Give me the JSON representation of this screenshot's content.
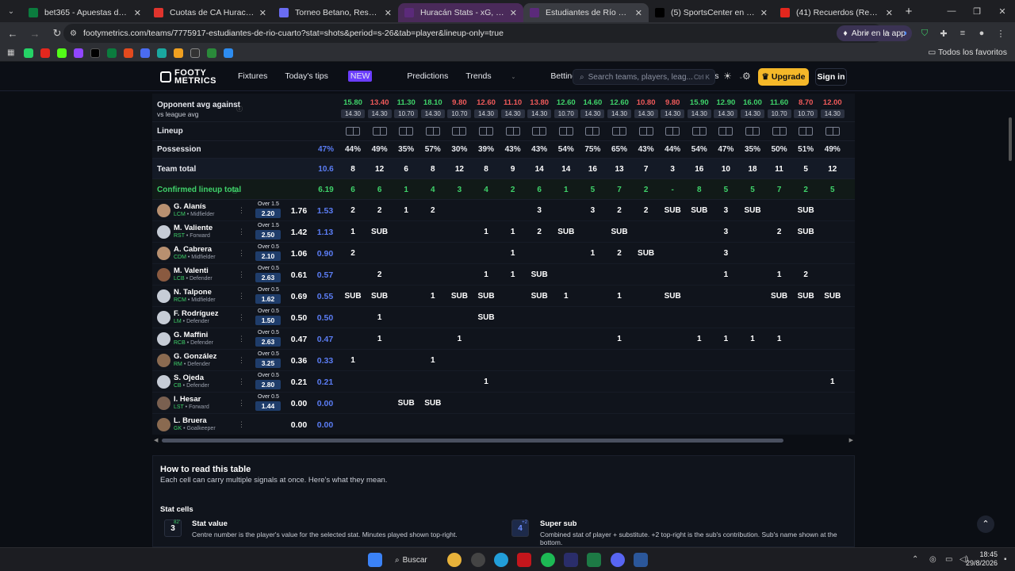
{
  "browser": {
    "tabs": [
      {
        "title": "bet365 - Apuestas deportivas e",
        "color": "#0b7c3e"
      },
      {
        "title": "Cuotas de CA Huracan - Estudi",
        "color": "#e0342d"
      },
      {
        "title": "Torneo Betano, Resultados",
        "color": "#6a6cf2"
      },
      {
        "title": "Huracán Stats - xG, Shots & Mi",
        "color": "#5b2a7a"
      },
      {
        "title": "Estudiantes de Río Cuarto Stats",
        "color": "#5b2a7a"
      },
      {
        "title": "(5) SportsCenter en X: \"¡EL SÁB",
        "color": "#000000"
      },
      {
        "title": "(41) Recuerdos (Remix) (fe",
        "color": "#e3271e"
      }
    ],
    "url": "footymetrics.com/teams/7775917-estudiantes-de-rio-cuarto?stat=shots&period=s-26&tab=player&lineup-only=true",
    "open_in_app": "Abrir en la app",
    "all_bookmarks": "Todos los favoritos"
  },
  "site": {
    "logo_line1": "FOOTY",
    "logo_line2": "METRICS",
    "nav": {
      "fixtures": "Fixtures",
      "tips": "Today's tips",
      "new": "NEW",
      "predictions": "Predictions",
      "trends": "Trends",
      "betting": "Betting tools",
      "stats": "Stats"
    },
    "search_placeholder": "Search teams, players, leag...",
    "search_kbd": "Ctrl K",
    "upgrade": "Upgrade",
    "signin": "Sign in"
  },
  "table": {
    "opp_label": "Opponent avg against",
    "opp_sub": "vs league avg",
    "lineup_label": "Lineup",
    "possession_label": "Possession",
    "possession_avg": "47%",
    "team_total_label": "Team total",
    "team_total_avg": "10.6",
    "confirmed_label": "Confirmed lineup total",
    "confirmed_avg": "6.19",
    "opp_top": [
      "15.80",
      "13.40",
      "11.30",
      "18.10",
      "9.80",
      "12.60",
      "11.10",
      "13.80",
      "12.60",
      "14.60",
      "12.60",
      "10.80",
      "9.80",
      "15.90",
      "12.90",
      "16.00",
      "11.60",
      "8.70",
      "12.00"
    ],
    "opp_top_colors": [
      "#3fd36a",
      "#f05a5a",
      "#3fd36a",
      "#3fd36a",
      "#f05a5a",
      "#f05a5a",
      "#f05a5a",
      "#f05a5a",
      "#3fd36a",
      "#3fd36a",
      "#3fd36a",
      "#f05a5a",
      "#f05a5a",
      "#3fd36a",
      "#3fd36a",
      "#3fd36a",
      "#3fd36a",
      "#f05a5a",
      "#f05a5a"
    ],
    "opp_bot": [
      "14.30",
      "14.30",
      "10.70",
      "14.30",
      "10.70",
      "14.30",
      "14.30",
      "14.30",
      "10.70",
      "14.30",
      "14.30",
      "14.30",
      "14.30",
      "14.30",
      "14.30",
      "14.30",
      "10.70",
      "10.70",
      "14.30"
    ],
    "possession": [
      "44%",
      "49%",
      "35%",
      "57%",
      "30%",
      "39%",
      "43%",
      "43%",
      "54%",
      "75%",
      "65%",
      "43%",
      "44%",
      "54%",
      "47%",
      "35%",
      "50%",
      "51%",
      "49%"
    ],
    "team_total": [
      "8",
      "12",
      "6",
      "8",
      "12",
      "8",
      "9",
      "14",
      "14",
      "16",
      "13",
      "7",
      "3",
      "16",
      "10",
      "18",
      "11",
      "5",
      "12"
    ],
    "confirmed": [
      "6",
      "6",
      "1",
      "4",
      "3",
      "4",
      "2",
      "6",
      "1",
      "5",
      "7",
      "2",
      "-",
      "8",
      "5",
      "5",
      "7",
      "2",
      "5"
    ],
    "players": [
      {
        "name": "G. Alanís",
        "code": "LCM",
        "role": "Midfielder",
        "over": "Over 1.5",
        "bet": "2.20",
        "avg": "1.76",
        "avg2": "1.53",
        "cells": [
          "2",
          "2",
          "1",
          "2",
          "",
          "",
          "",
          "3",
          "",
          "3",
          "2",
          "2",
          "SUB",
          "SUB",
          "3",
          "SUB",
          "",
          "SUB",
          ""
        ]
      },
      {
        "name": "M. Valiente",
        "code": "RST",
        "role": "Forward",
        "over": "Over 1.5",
        "bet": "2.50",
        "avg": "1.42",
        "avg2": "1.13",
        "cells": [
          "1",
          "SUB",
          "",
          "",
          "",
          "1",
          "1",
          "2",
          "SUB",
          "",
          "SUB",
          "",
          "",
          "",
          "3",
          "",
          "2",
          "SUB",
          ""
        ]
      },
      {
        "name": "A. Cabrera",
        "code": "CDM",
        "role": "Midfielder",
        "over": "Over 0.5",
        "bet": "2.10",
        "avg": "1.06",
        "avg2": "0.90",
        "cells": [
          "2",
          "",
          "",
          "",
          "",
          "",
          "1",
          "",
          "",
          "1",
          "2",
          "SUB",
          "",
          "",
          "3",
          "",
          "",
          "",
          ""
        ]
      },
      {
        "name": "M. Valenti",
        "code": "LCB",
        "role": "Defender",
        "over": "Over 0.5",
        "bet": "2.63",
        "avg": "0.61",
        "avg2": "0.57",
        "cells": [
          "",
          "2",
          "",
          "",
          "",
          "1",
          "1",
          "SUB",
          "",
          "",
          "",
          "",
          "",
          "",
          "1",
          "",
          "1",
          "2",
          ""
        ]
      },
      {
        "name": "N. Talpone",
        "code": "RCM",
        "role": "Midfielder",
        "over": "Over 0.5",
        "bet": "1.62",
        "avg": "0.69",
        "avg2": "0.55",
        "cells": [
          "SUB",
          "SUB",
          "",
          "1",
          "SUB",
          "SUB",
          "",
          "SUB",
          "1",
          "",
          "1",
          "",
          "SUB",
          "",
          "",
          "",
          "SUB",
          "SUB",
          "SUB"
        ]
      },
      {
        "name": "F. Rodríguez",
        "code": "LM",
        "role": "Defender",
        "over": "Over 0.5",
        "bet": "1.50",
        "avg": "0.50",
        "avg2": "0.50",
        "cells": [
          "",
          "1",
          "",
          "",
          "",
          "SUB",
          "",
          "",
          "",
          "",
          "",
          "",
          "",
          "",
          "",
          "",
          "",
          "",
          ""
        ]
      },
      {
        "name": "G. Maffini",
        "code": "RCB",
        "role": "Defender",
        "over": "Over 0.5",
        "bet": "2.63",
        "avg": "0.47",
        "avg2": "0.47",
        "cells": [
          "",
          "1",
          "",
          "",
          "1",
          "",
          "",
          "",
          "",
          "",
          "1",
          "",
          "",
          "1",
          "1",
          "1",
          "1",
          "",
          ""
        ]
      },
      {
        "name": "G. González",
        "code": "RM",
        "role": "Defender",
        "over": "Over 0.5",
        "bet": "3.25",
        "avg": "0.36",
        "avg2": "0.33",
        "cells": [
          "1",
          "",
          "",
          "1",
          "",
          "",
          "",
          "",
          "",
          "",
          "",
          "",
          "",
          "",
          "",
          "",
          "",
          "",
          ""
        ]
      },
      {
        "name": "S. Ojeda",
        "code": "CB",
        "role": "Defender",
        "over": "Over 0.5",
        "bet": "2.80",
        "avg": "0.21",
        "avg2": "0.21",
        "cells": [
          "",
          "",
          "",
          "",
          "",
          "1",
          "",
          "",
          "",
          "",
          "",
          "",
          "",
          "",
          "",
          "",
          "",
          "",
          "1"
        ]
      },
      {
        "name": "I. Hesar",
        "code": "LST",
        "role": "Forward",
        "over": "Over 0.5",
        "bet": "1.44",
        "avg": "0.00",
        "avg2": "0.00",
        "cells": [
          "",
          "",
          "SUB",
          "SUB",
          "",
          "",
          "",
          "",
          "",
          "",
          "",
          "",
          "",
          "",
          "",
          "",
          "",
          "",
          ""
        ]
      },
      {
        "name": "L. Bruera",
        "code": "GK",
        "role": "Goalkeeper",
        "over": "",
        "bet": "",
        "avg": "0.00",
        "avg2": "0.00",
        "cells": [
          "",
          "",
          "",
          "",
          "",
          "",
          "",
          "",
          "",
          "",
          "",
          "",
          "",
          "",
          "",
          "",
          "",
          "",
          ""
        ]
      }
    ]
  },
  "howto": {
    "title": "How to read this table",
    "subtitle": "Each cell can carry multiple signals at once. Here's what they mean.",
    "section": "Stat cells",
    "stat_value_title": "Stat value",
    "stat_value_desc": "Centre number is the player's value for the selected stat. Minutes played shown top-right.",
    "stat_value_num": "3",
    "stat_value_min": "82'",
    "super_sub_title": "Super sub",
    "super_sub_desc": "Combined stat of player + substitute. +2 top-right is the sub's contribution. Sub's name shown at the bottom.",
    "super_sub_num": "4",
    "super_sub_plus": "+2"
  },
  "taskbar": {
    "search": "Buscar",
    "time": "18:45",
    "date": "29/8/2026"
  }
}
